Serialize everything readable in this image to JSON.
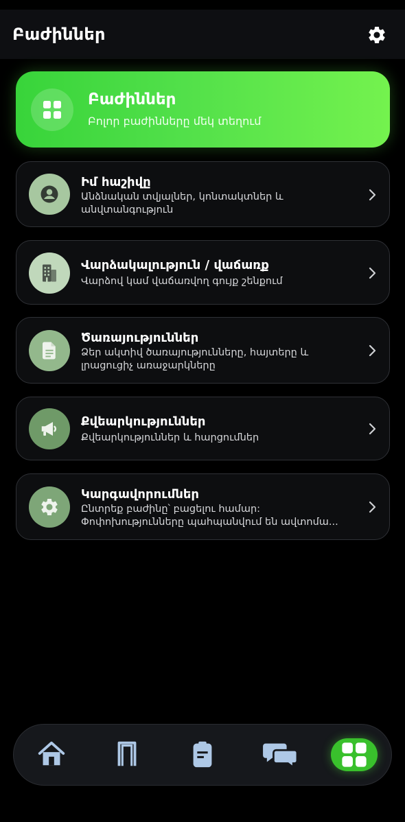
{
  "appbar": {
    "title": "Բաժիններ",
    "icon": "gear-icon"
  },
  "hero": {
    "title": "Բաժիններ",
    "subtitle": "Բոլոր բաժինները մեկ տեղում",
    "icon": "grid-icon"
  },
  "cards": [
    {
      "title": "Իմ հաշիվը",
      "desc": "Անձնական տվյալներ, կոնտակտներ և անվտանգություն",
      "icon": "account-icon",
      "icon_bg": "#a7c7a0"
    },
    {
      "title": "Վարձակալություն / վաճառք",
      "desc": "Վարձով կամ վաճառվող գույք շենքում",
      "icon": "building-icon",
      "icon_bg": "#c0d8bb"
    },
    {
      "title": "Ծառայություններ",
      "desc": "Ձեր ակտիվ ծառայությունները, հայտերը և լրացուցիչ առաջարկները",
      "icon": "document-icon",
      "icon_bg": "#93b88c"
    },
    {
      "title": "Քվեարկություններ",
      "desc": "Քվեարկություններ և հարցումներ",
      "icon": "megaphone-icon",
      "icon_bg": "#6f9a68"
    },
    {
      "title": "Կարգավորումներ",
      "desc": "Ընտրեք բաժինը՝ բացելու համար: Փոփոխությունները պահպանվում են ավտոմա...",
      "icon": "settings-icon",
      "icon_bg": "#7ea678"
    }
  ],
  "nav": {
    "items": [
      "home-icon",
      "door-icon",
      "clipboard-icon",
      "chat-icon",
      "grid-icon"
    ],
    "active": "grid-icon",
    "accent": "#39c02c"
  }
}
